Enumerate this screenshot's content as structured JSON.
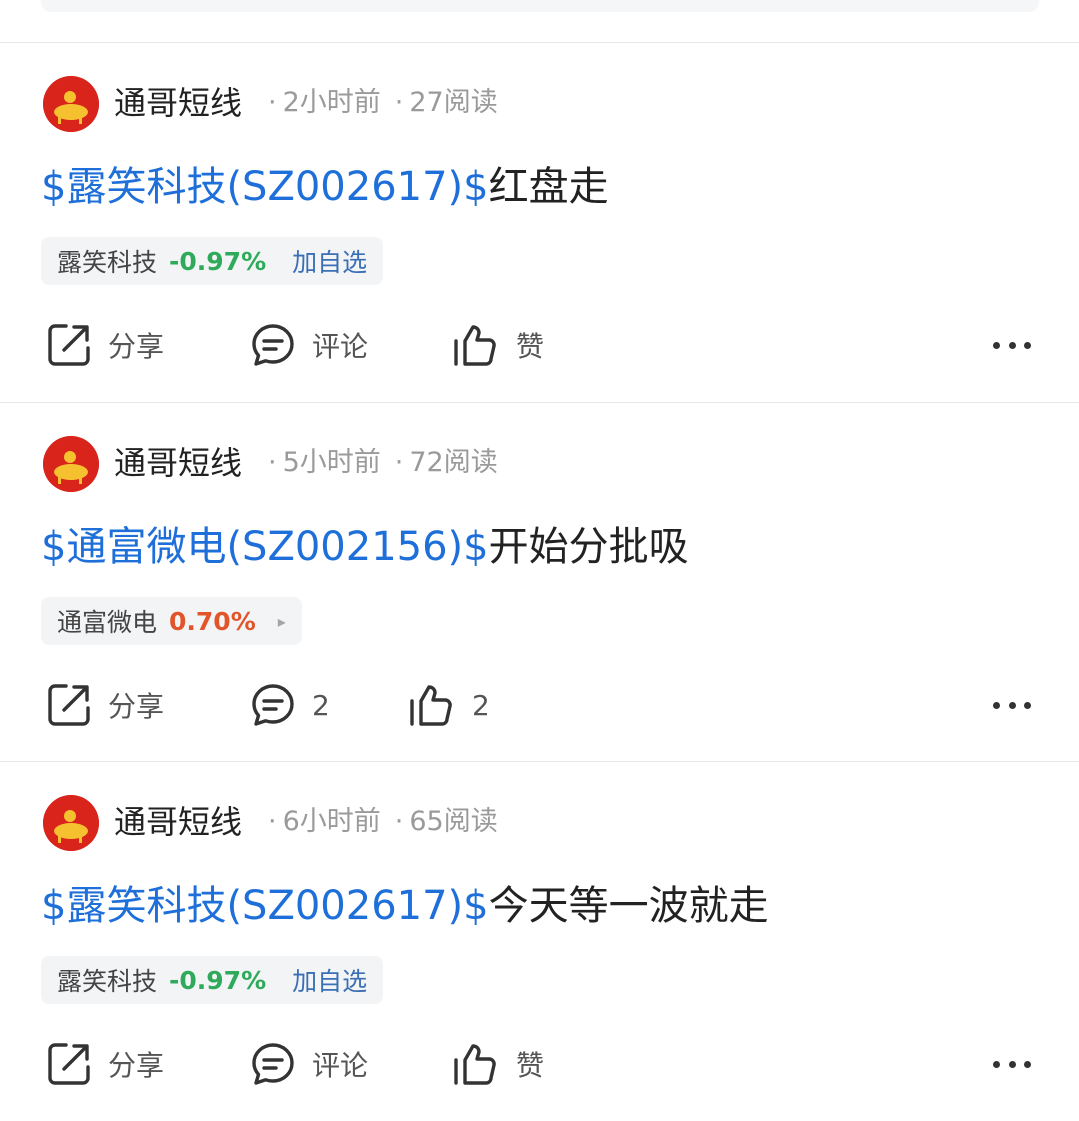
{
  "posts": [
    {
      "author": "通哥短线",
      "time": "2小时前",
      "reads": "27阅读",
      "stock_ref": "$露笑科技(SZ002617)$",
      "text": "红盘走",
      "tag": {
        "name": "露笑科技",
        "change": "-0.97%",
        "direction": "down",
        "action": "加自选"
      },
      "share_label": "分享",
      "comment_label": "评论",
      "like_label": "赞"
    },
    {
      "author": "通哥短线",
      "time": "5小时前",
      "reads": "72阅读",
      "stock_ref": "$通富微电(SZ002156)$",
      "text": "开始分批吸",
      "tag": {
        "name": "通富微电",
        "change": "0.70%",
        "direction": "up",
        "action": "▸"
      },
      "share_label": "分享",
      "comment_label": "2",
      "like_label": "2"
    },
    {
      "author": "通哥短线",
      "time": "6小时前",
      "reads": "65阅读",
      "stock_ref": "$露笑科技(SZ002617)$",
      "text": "今天等一波就走",
      "tag": {
        "name": "露笑科技",
        "change": "-0.97%",
        "direction": "down",
        "action": "加自选"
      },
      "share_label": "分享",
      "comment_label": "评论",
      "like_label": "赞"
    }
  ],
  "colors": {
    "stock_link": "#1e6fd9",
    "down": "#2eaa5a",
    "up": "#e2552b",
    "add": "#3b6fb5"
  },
  "icons": [
    "share-icon",
    "comment-icon",
    "like-icon",
    "more-icon",
    "avatar-ox"
  ]
}
